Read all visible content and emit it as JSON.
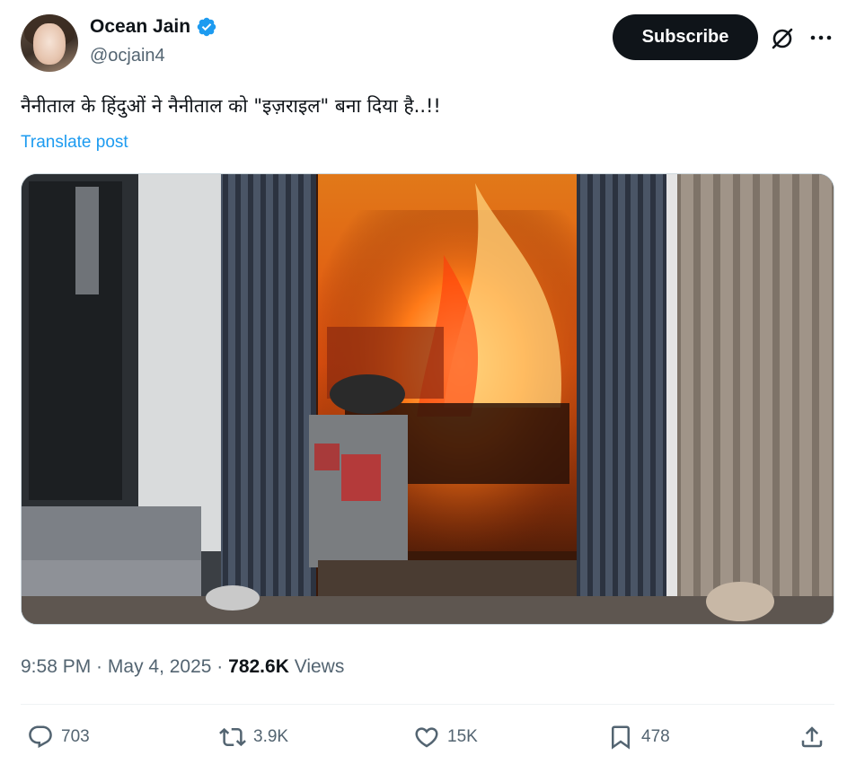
{
  "author": {
    "display_name": "Ocean Jain",
    "handle": "@ocjain4",
    "verified": true,
    "avatar_icon": "profile-photo"
  },
  "header": {
    "subscribe_label": "Subscribe",
    "grok_icon": "grok-icon",
    "more_icon": "more-horizontal-icon"
  },
  "post": {
    "text": "नैनीताल के हिंदुओं ने नैनीताल को \"इज़राइल\" बना दिया है..!!",
    "translate_label": "Translate post",
    "media_description": "video-thumbnail"
  },
  "meta": {
    "time": "9:58 PM",
    "separator1": " · ",
    "date": "May 4, 2025",
    "separator2": " · ",
    "views_count": "782.6K",
    "views_label": " Views"
  },
  "actions": {
    "replies": "703",
    "reposts": "3.9K",
    "likes": "15K",
    "bookmarks": "478"
  },
  "colors": {
    "accent": "#1d9bf0",
    "text": "#0f1419",
    "muted": "#536471",
    "button": "#0f1419"
  }
}
